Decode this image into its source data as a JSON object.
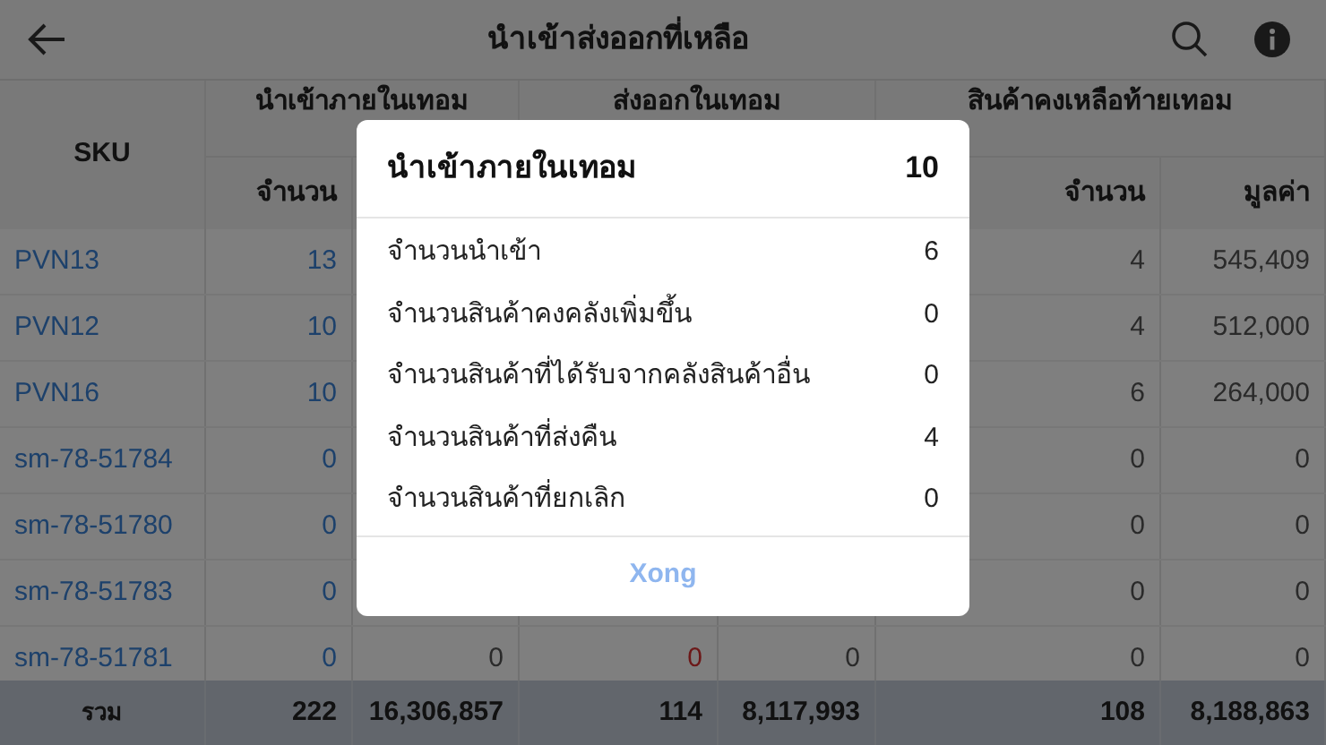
{
  "app_bar": {
    "title": "นำเข้าส่งออกที่เหลือ"
  },
  "table": {
    "sku_header": "SKU",
    "groups": [
      {
        "label": "นำเข้าภายในเทอม",
        "subheaders": [
          "จำนวน"
        ]
      },
      {
        "label": "ส่งออกในเทอม"
      },
      {
        "label": "สินค้าคงเหลือท้ายเทอม",
        "subheaders": [
          "จำนวน",
          "มูลค่า"
        ]
      }
    ],
    "rows": [
      {
        "sku": "PVN13",
        "import_qty": "13",
        "stock_qty": "4",
        "stock_value": "545,409"
      },
      {
        "sku": "PVN12",
        "import_qty": "10",
        "stock_qty": "4",
        "stock_value": "512,000"
      },
      {
        "sku": "PVN16",
        "import_qty": "10",
        "stock_qty": "6",
        "stock_value": "264,000"
      },
      {
        "sku": "sm-78-51784",
        "import_qty": "0",
        "stock_qty": "0",
        "stock_value": "0"
      },
      {
        "sku": "sm-78-51780",
        "import_qty": "0",
        "stock_qty": "0",
        "stock_value": "0"
      },
      {
        "sku": "sm-78-51783",
        "import_qty": "0",
        "stock_qty": "0",
        "stock_value": "0"
      },
      {
        "sku": "sm-78-51781",
        "import_qty": "0",
        "import_value": "0",
        "export_qty": "0",
        "export_qty_alert": true,
        "export_value": "0",
        "stock_qty": "0",
        "stock_value": "0"
      }
    ],
    "totals": {
      "label": "รวม",
      "import_qty": "222",
      "import_value": "16,306,857",
      "export_qty": "114",
      "export_value": "8,117,993",
      "stock_qty": "108",
      "stock_value": "8,188,863"
    }
  },
  "dialog": {
    "title": "นำเข้าภายในเทอม",
    "total": "10",
    "items": [
      {
        "label": "จำนวนนำเข้า",
        "value": "6"
      },
      {
        "label": "จำนวนสินค้าคงคลังเพิ่มขึ้น",
        "value": "0"
      },
      {
        "label": "จำนวนสินค้าที่ได้รับจากคลังสินค้าอื่น",
        "value": "0"
      },
      {
        "label": "จำนวนสินค้าที่ส่งคืน",
        "value": "4"
      },
      {
        "label": "จำนวนสินค้าที่ยกเลิก",
        "value": "0"
      }
    ],
    "button": "Xong"
  }
}
